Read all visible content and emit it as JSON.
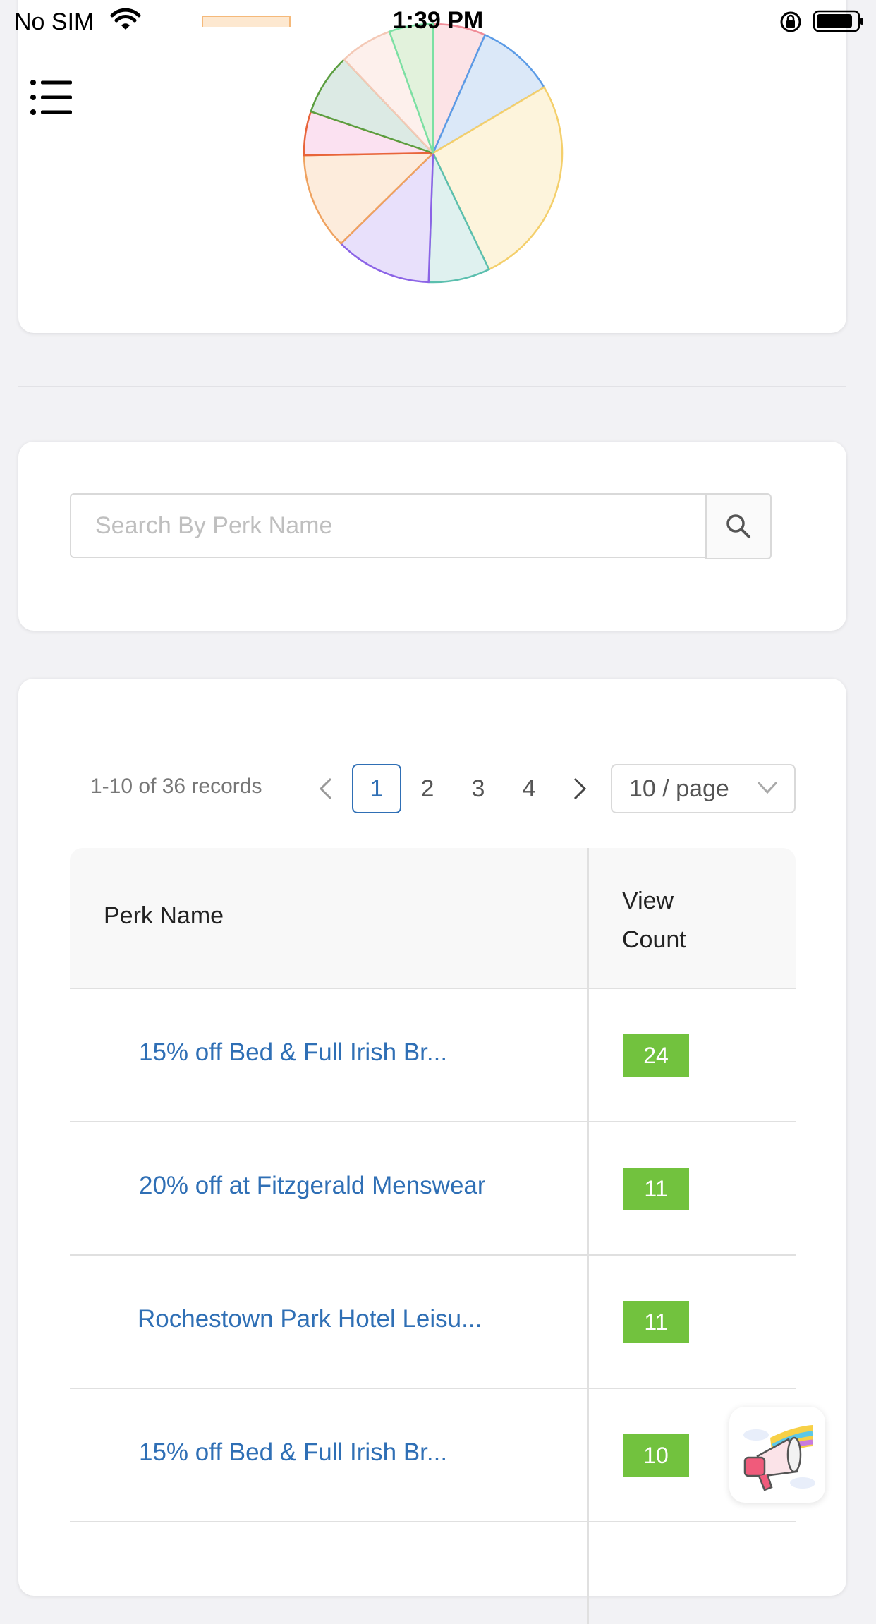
{
  "status_bar": {
    "carrier": "No SIM",
    "time": "1:39 PM",
    "wifi_icon": "wifi-icon",
    "lock_icon": "orientation-lock-icon",
    "battery_icon": "battery-icon"
  },
  "header": {
    "menu_icon": "list-menu-icon"
  },
  "chart_data": {
    "type": "pie",
    "slices": [
      {
        "value": 6,
        "color": "#f08c97",
        "fill": "#fce3e6"
      },
      {
        "value": 9,
        "color": "#5b9be6",
        "fill": "#dbe8f8"
      },
      {
        "value": 24,
        "color": "#f4cf6b",
        "fill": "#fdf4dc"
      },
      {
        "value": 7,
        "color": "#5bbfae",
        "fill": "#dff1ef"
      },
      {
        "value": 11,
        "color": "#8b63e6",
        "fill": "#e8e0fb"
      },
      {
        "value": 11,
        "color": "#efa25f",
        "fill": "#fdecdc"
      },
      {
        "value": 5,
        "color": "#e8643a",
        "fill": "#fbe1f1"
      },
      {
        "value": 7,
        "color": "#5b9e3f",
        "fill": "#dceae4"
      },
      {
        "value": 6,
        "color": "#f4c9b6",
        "fill": "#fdf0ec"
      },
      {
        "value": 5,
        "color": "#7be0a3",
        "fill": "#e2f2dc"
      }
    ]
  },
  "search": {
    "placeholder": "Search By Perk Name",
    "value": "",
    "button_icon": "search-icon"
  },
  "pagination": {
    "summary": "1-10 of 36 records",
    "prev": "<",
    "pages": [
      "1",
      "2",
      "3",
      "4"
    ],
    "current": "1",
    "next": ">",
    "page_size": "10 / page"
  },
  "table": {
    "columns": [
      "Perk Name",
      "View Count"
    ],
    "rows": [
      {
        "name": "15% off Bed & Full Irish Br...",
        "count": "24"
      },
      {
        "name": "20% off at Fitzgerald Menswear",
        "count": "11"
      },
      {
        "name": "Rochestown Park Hotel Leisu...",
        "count": "11"
      },
      {
        "name": "15% off Bed & Full Irish Br...",
        "count": "10"
      }
    ]
  },
  "colors": {
    "accent": "#2f6fb5",
    "badge": "#72c23e",
    "background": "#f2f2f5"
  },
  "fab_icon": "megaphone-icon"
}
